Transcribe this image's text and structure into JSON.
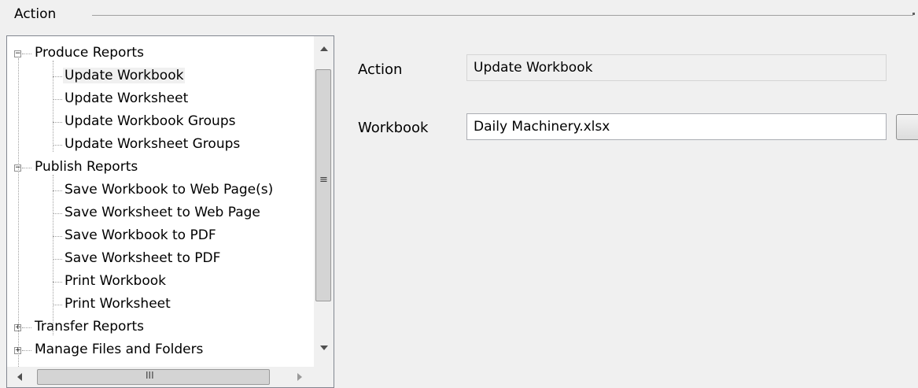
{
  "group": {
    "title": "Action"
  },
  "tree": {
    "nodes": [
      {
        "label": "Produce Reports",
        "level": 0,
        "expander": "−"
      },
      {
        "label": "Update Workbook",
        "level": 1,
        "selected": true
      },
      {
        "label": "Update Worksheet",
        "level": 1
      },
      {
        "label": "Update Workbook Groups",
        "level": 1
      },
      {
        "label": "Update Worksheet Groups",
        "level": 1
      },
      {
        "label": "Publish Reports",
        "level": 0,
        "expander": "−"
      },
      {
        "label": "Save Workbook to Web Page(s)",
        "level": 1
      },
      {
        "label": "Save Worksheet to Web Page",
        "level": 1
      },
      {
        "label": "Save Workbook to PDF",
        "level": 1
      },
      {
        "label": "Save Worksheet to PDF",
        "level": 1
      },
      {
        "label": "Print Workbook",
        "level": 1
      },
      {
        "label": "Print Worksheet",
        "level": 1
      },
      {
        "label": "Transfer Reports",
        "level": 0,
        "expander": "+"
      },
      {
        "label": "Manage Files and Folders",
        "level": 0,
        "expander": "+"
      }
    ],
    "vscroll_grip": "≡",
    "hscroll_grip": "III"
  },
  "form": {
    "action_label": "Action",
    "action_value": "Update Workbook",
    "workbook_label": "Workbook",
    "workbook_value": "Daily Machinery.xlsx"
  }
}
